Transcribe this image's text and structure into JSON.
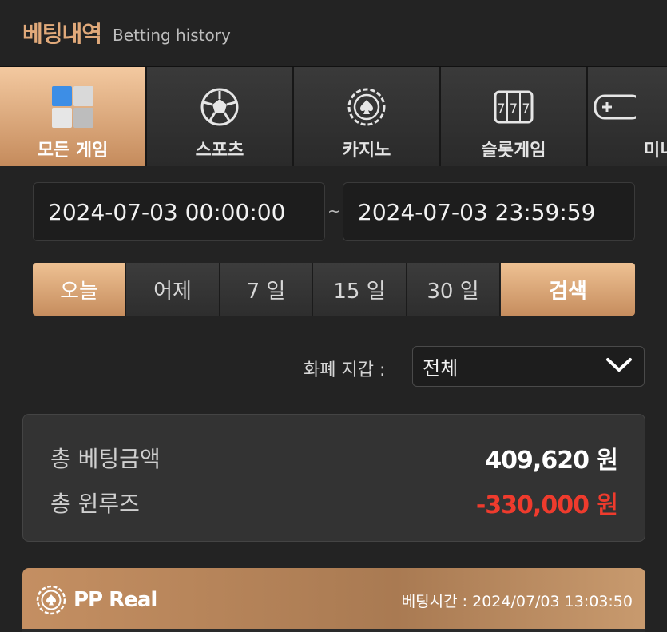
{
  "header": {
    "title": "베팅내역",
    "subtitle": "Betting history"
  },
  "tabs": [
    {
      "label": "모든 게임",
      "icon": "all-games-cube-icon",
      "active": true
    },
    {
      "label": "스포츠",
      "icon": "soccer-ball-icon",
      "active": false
    },
    {
      "label": "카지노",
      "icon": "casino-chip-icon",
      "active": false
    },
    {
      "label": "슬롯게임",
      "icon": "slot-machine-icon",
      "active": false
    },
    {
      "label": "미니",
      "icon": "gamepad-icon",
      "active": false
    }
  ],
  "date_range": {
    "start": "2024-07-03 00:00:00",
    "separator": "~",
    "end": "2024-07-03 23:59:59"
  },
  "periods": [
    {
      "label": "오늘",
      "active": true
    },
    {
      "label": "어제",
      "active": false
    },
    {
      "label": "7 일",
      "active": false
    },
    {
      "label": "15 일",
      "active": false
    },
    {
      "label": "30 일",
      "active": false
    }
  ],
  "search_label": "검색",
  "currency": {
    "label": "화폐 지갑 :",
    "selected": "전체"
  },
  "summary": {
    "total_bet_label": "총 베팅금액",
    "total_bet_value": "409,620 원",
    "total_winloss_label": "총 윈루즈",
    "total_winloss_value": "-330,000 원"
  },
  "bet": {
    "game": "PP Real",
    "icon": "casino-chip-icon",
    "time_label": "베팅시간 : 2024/07/03 13:03:50"
  },
  "colors": {
    "accent": "#c68d5e",
    "negative": "#ef3b2d",
    "title": "#e0a97a"
  }
}
